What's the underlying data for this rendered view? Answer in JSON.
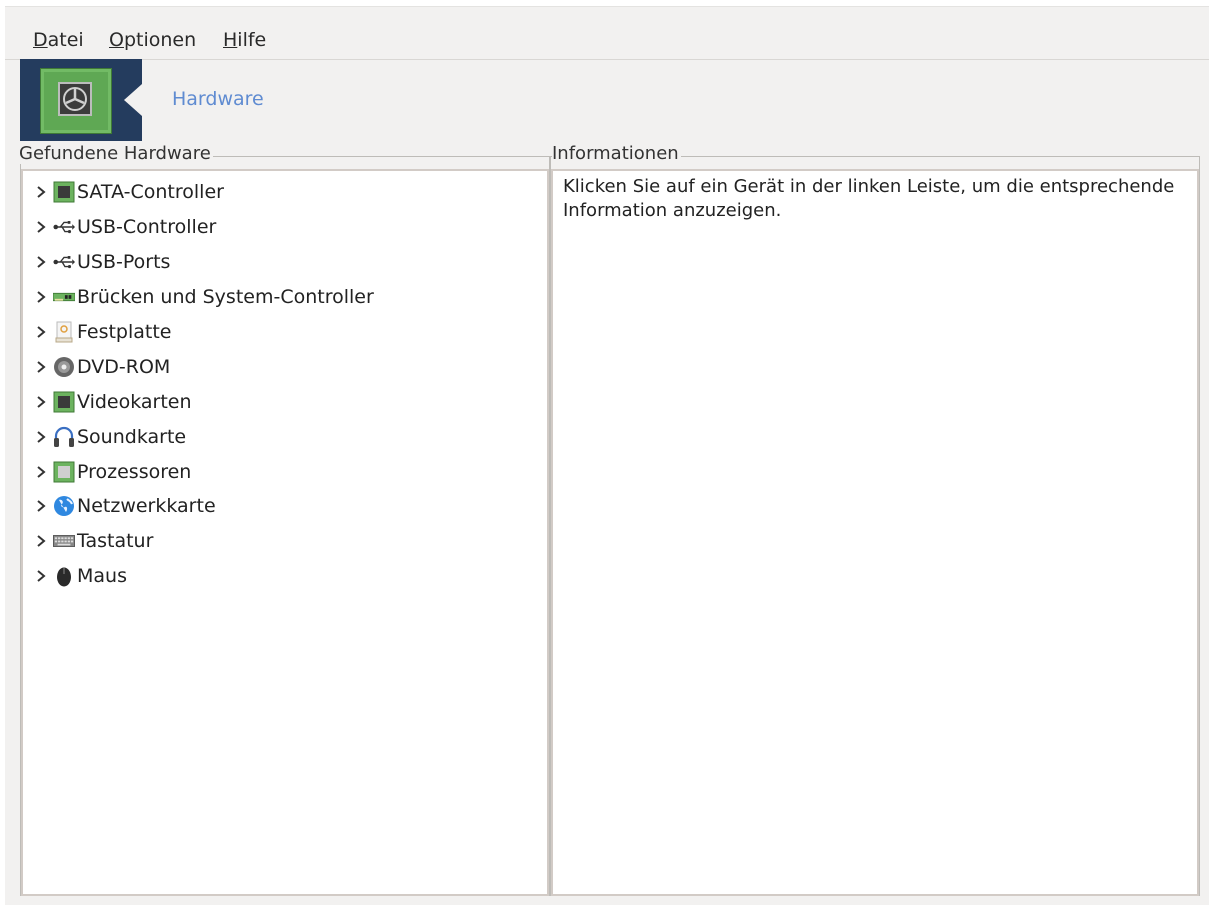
{
  "menu": {
    "items": [
      {
        "mnemonic": "D",
        "rest": "atei"
      },
      {
        "mnemonic": "O",
        "rest": "ptionen"
      },
      {
        "mnemonic": "H",
        "rest": "ilfe"
      }
    ]
  },
  "banner": {
    "title": "Hardware",
    "icon": "hardware-chip-icon"
  },
  "left_panel": {
    "label": "Gefundene Hardware",
    "items": [
      {
        "label": "SATA-Controller",
        "icon": "chip-icon"
      },
      {
        "label": "USB-Controller",
        "icon": "usb-icon"
      },
      {
        "label": "USB-Ports",
        "icon": "usb-icon"
      },
      {
        "label": "Brücken und System-Controller",
        "icon": "pci-card-icon"
      },
      {
        "label": "Festplatte",
        "icon": "harddisk-icon"
      },
      {
        "label": "DVD-ROM",
        "icon": "dvd-icon"
      },
      {
        "label": "Videokarten",
        "icon": "chip-icon"
      },
      {
        "label": "Soundkarte",
        "icon": "headphones-icon"
      },
      {
        "label": "Prozessoren",
        "icon": "cpu-icon"
      },
      {
        "label": "Netzwerkkarte",
        "icon": "globe-icon"
      },
      {
        "label": "Tastatur",
        "icon": "keyboard-icon"
      },
      {
        "label": "Maus",
        "icon": "mouse-icon"
      }
    ]
  },
  "right_panel": {
    "label": "Informationen",
    "text": "Klicken Sie auf ein Gerät in der linken Leiste, um die entsprechende Information anzuzeigen."
  },
  "colors": {
    "window_bg": "#f2f1f0",
    "banner_bg": "#243c5e",
    "banner_title": "#5f8bd1",
    "chip_green": "#5fa854"
  }
}
